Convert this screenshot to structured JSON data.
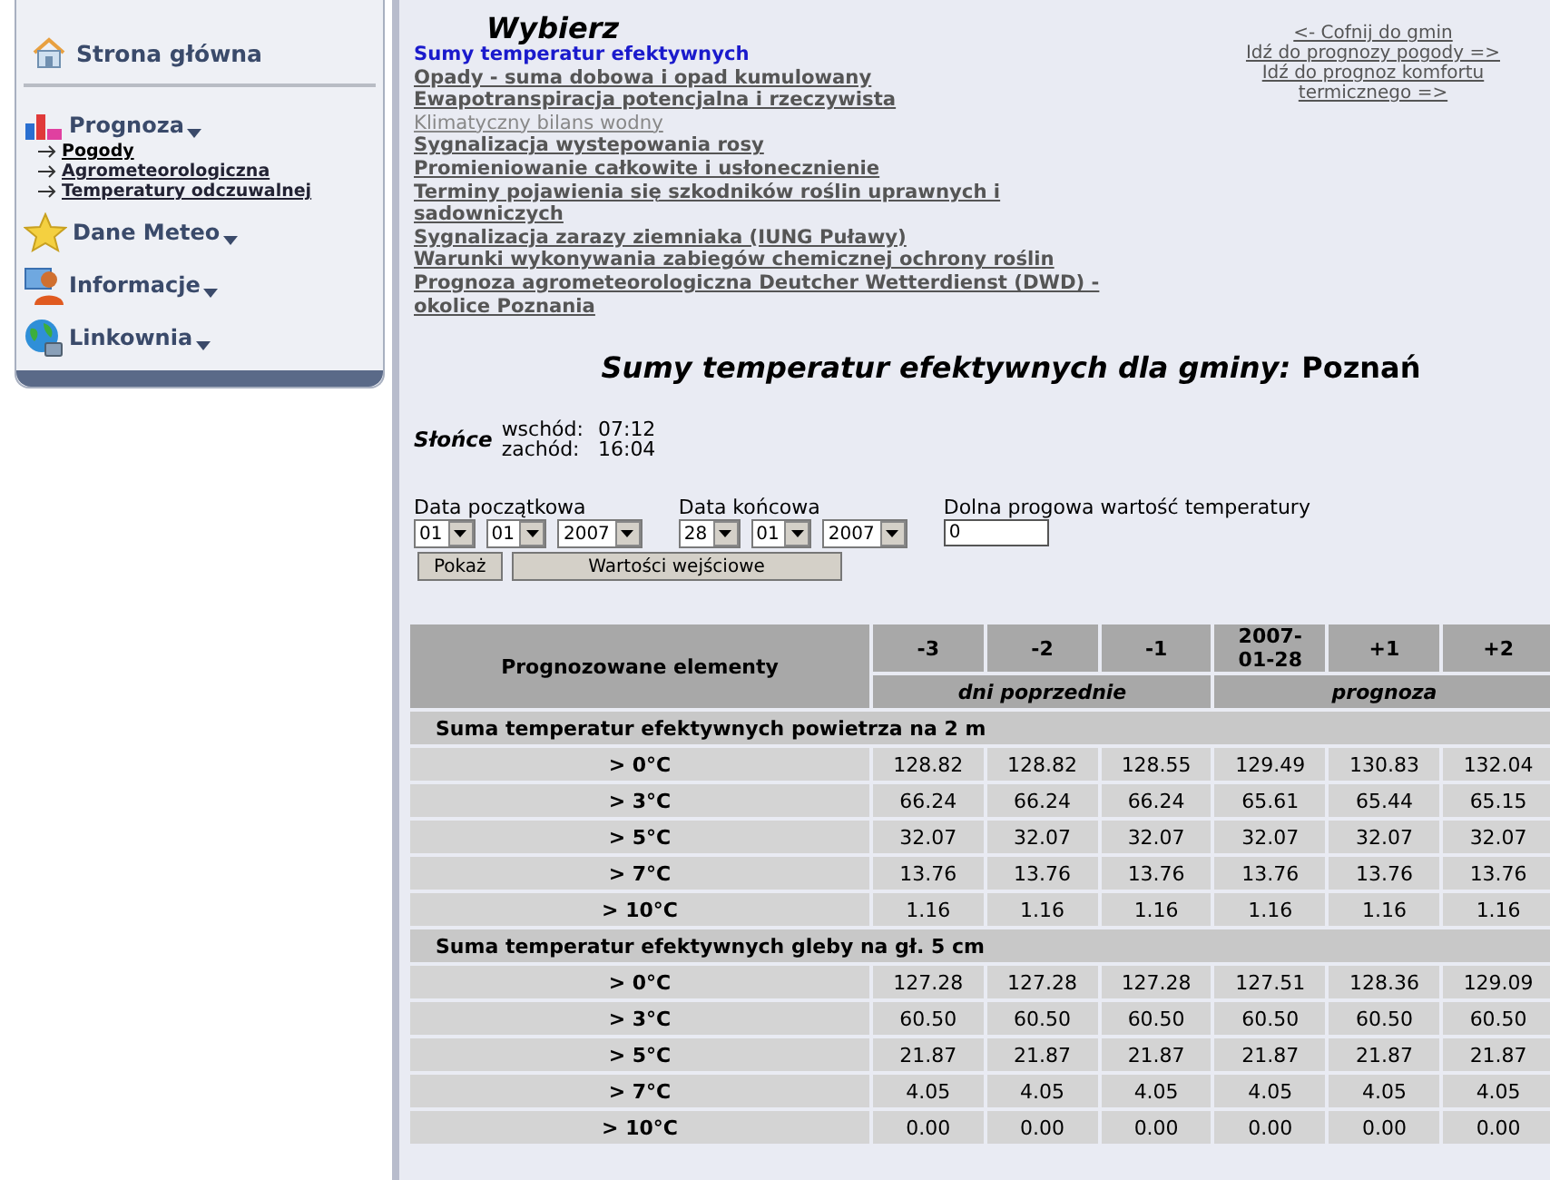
{
  "sidebar": {
    "home": {
      "label": "Strona główna"
    },
    "menus": [
      {
        "label": "Prognoza",
        "children": [
          {
            "label": "Pogody",
            "selected": true
          },
          {
            "label": "Agrometeorologiczna",
            "selected": false
          },
          {
            "label": "Temperatury odczuwalnej",
            "selected": false
          }
        ]
      },
      {
        "label": "Dane Meteo"
      },
      {
        "label": "Informacje"
      },
      {
        "label": "Linkownia"
      }
    ]
  },
  "chooser": {
    "title": "Wybierz",
    "links": [
      {
        "label": "Sumy temperatur efektywnych",
        "selected": true,
        "disabled": false
      },
      {
        "label": "Opady - suma dobowa i opad kumulowany",
        "selected": false,
        "disabled": false
      },
      {
        "label": "Ewapotranspiracja potencjalna i rzeczywista",
        "selected": false,
        "disabled": false
      },
      {
        "label": "Klimatyczny bilans wodny",
        "selected": false,
        "disabled": true
      },
      {
        "label": "Sygnalizacja wystepowania rosy",
        "selected": false,
        "disabled": false
      },
      {
        "label": "Promieniowanie całkowite i usłonecznienie",
        "selected": false,
        "disabled": false
      },
      {
        "label": "Terminy pojawienia się szkodników roślin uprawnych i sadowniczych",
        "selected": false,
        "disabled": false
      },
      {
        "label": "Sygnalizacja zarazy ziemniaka (IUNG Puławy)",
        "selected": false,
        "disabled": false
      },
      {
        "label": "Warunki wykonywania zabiegów chemicznej ochrony roślin",
        "selected": false,
        "disabled": false
      },
      {
        "label": "Prognoza agrometeorologiczna Deutcher Wetterdienst (DWD) - okolice Poznania",
        "selected": false,
        "disabled": false
      }
    ]
  },
  "nav_links": [
    "<- Cofnij do gmin",
    "Idź do prognozy pogody =>",
    "Idź do prognoz komfortu termicznego =>"
  ],
  "heading": {
    "title": "Sumy temperatur efektywnych dla gminy:",
    "place": "Poznań"
  },
  "sun": {
    "label": "Słońce",
    "rows": [
      {
        "name": "wschód:",
        "time": "07:12"
      },
      {
        "name": "zachód:",
        "time": "16:04"
      }
    ]
  },
  "form": {
    "dates": [
      {
        "label": "Data początkowa",
        "selects": [
          "01",
          "01",
          "2007"
        ]
      },
      {
        "label": "Data końcowa",
        "selects": [
          "28",
          "01",
          "2007"
        ]
      }
    ],
    "threshold": {
      "label": "Dolna progowa wartość temperatury",
      "value": "0"
    },
    "buttons": [
      "Pokaż",
      "Wartości wejściowe"
    ]
  },
  "table": {
    "corner": "Prognozowane elementy",
    "columns": [
      "-3",
      "-2",
      "-1",
      "2007-01-28",
      "+1",
      "+2"
    ],
    "spans": [
      {
        "label": "dni poprzednie"
      },
      {
        "label": "prognoza"
      }
    ],
    "groups": [
      {
        "title": "Suma temperatur efektywnych powietrza na 2 m",
        "rows": [
          {
            "label": "> 0°C",
            "values": [
              "128.82",
              "128.82",
              "128.55",
              "129.49",
              "130.83",
              "132.04"
            ]
          },
          {
            "label": "> 3°C",
            "values": [
              "66.24",
              "66.24",
              "66.24",
              "65.61",
              "65.44",
              "65.15"
            ]
          },
          {
            "label": "> 5°C",
            "values": [
              "32.07",
              "32.07",
              "32.07",
              "32.07",
              "32.07",
              "32.07"
            ]
          },
          {
            "label": "> 7°C",
            "values": [
              "13.76",
              "13.76",
              "13.76",
              "13.76",
              "13.76",
              "13.76"
            ]
          },
          {
            "label": "> 10°C",
            "values": [
              "1.16",
              "1.16",
              "1.16",
              "1.16",
              "1.16",
              "1.16"
            ]
          }
        ]
      },
      {
        "title": "Suma temperatur efektywnych gleby na gł. 5 cm",
        "rows": [
          {
            "label": "> 0°C",
            "values": [
              "127.28",
              "127.28",
              "127.28",
              "127.51",
              "128.36",
              "129.09"
            ]
          },
          {
            "label": "> 3°C",
            "values": [
              "60.50",
              "60.50",
              "60.50",
              "60.50",
              "60.50",
              "60.50"
            ]
          },
          {
            "label": "> 5°C",
            "values": [
              "21.87",
              "21.87",
              "21.87",
              "21.87",
              "21.87",
              "21.87"
            ]
          },
          {
            "label": "> 7°C",
            "values": [
              "4.05",
              "4.05",
              "4.05",
              "4.05",
              "4.05",
              "4.05"
            ]
          },
          {
            "label": "> 10°C",
            "values": [
              "0.00",
              "0.00",
              "0.00",
              "0.00",
              "0.00",
              "0.00"
            ]
          }
        ]
      }
    ]
  }
}
